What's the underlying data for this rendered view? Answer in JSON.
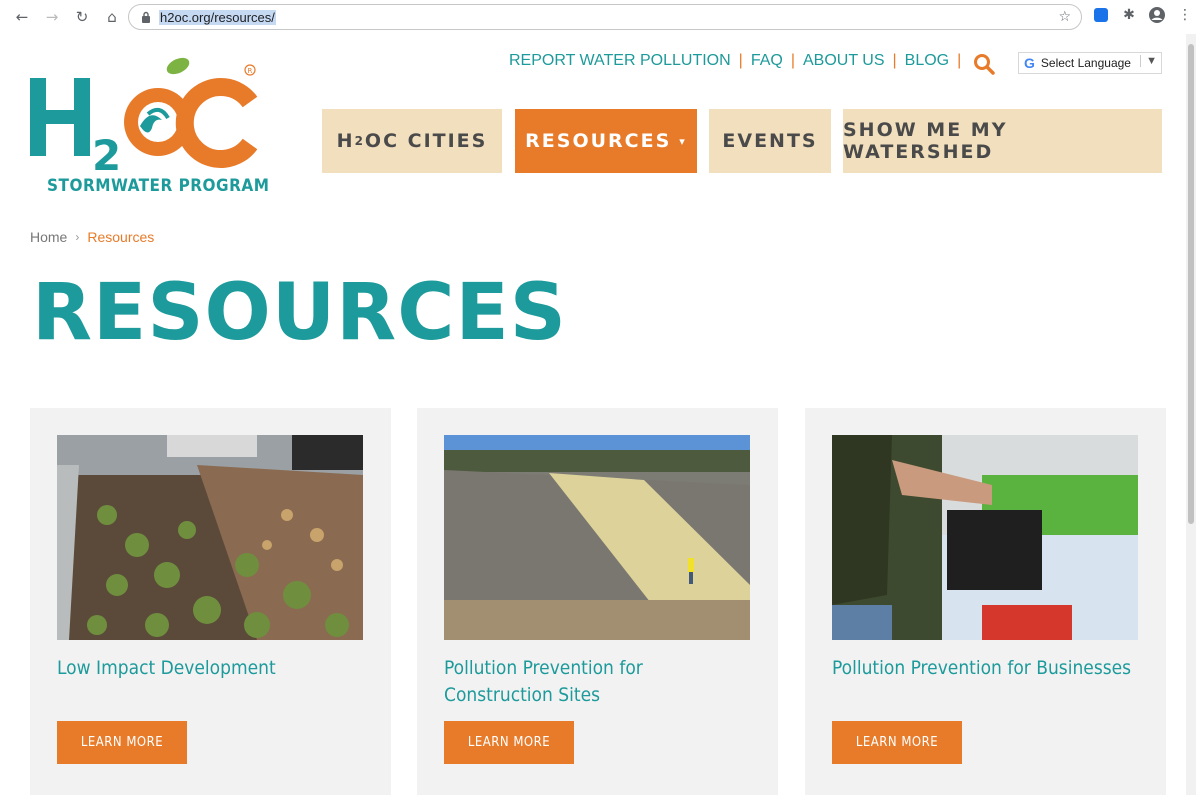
{
  "browser": {
    "url": "h2oc.org/resources/"
  },
  "header": {
    "logo_text": "H2OC",
    "logo_subtitle": "STORMWATER PROGRAM",
    "utility_links": [
      "REPORT WATER POLLUTION",
      "FAQ",
      "ABOUT US",
      "BLOG"
    ],
    "language_label": "Select Language",
    "nav": {
      "cities_main": "H",
      "cities_sub": "2",
      "cities_rest": "OC CITIES",
      "resources": "RESOURCES",
      "events": "EVENTS",
      "watershed": "SHOW ME MY WATERSHED"
    }
  },
  "breadcrumb": {
    "home": "Home",
    "current": "Resources"
  },
  "page_title": "RESOURCES",
  "cards": [
    {
      "title": "Low Impact Development",
      "button": "LEARN MORE",
      "image": "rain-garden-photo"
    },
    {
      "title": "Pollution Prevention for Construction Sites",
      "button": "LEARN MORE",
      "image": "construction-slope-photo"
    },
    {
      "title": "Pollution Prevention for Businesses",
      "button": "LEARN MORE",
      "image": "battery-disposal-photo"
    }
  ],
  "colors": {
    "teal": "#1d9a9b",
    "orange": "#e87b2a",
    "beige": "#f2dfbe"
  }
}
